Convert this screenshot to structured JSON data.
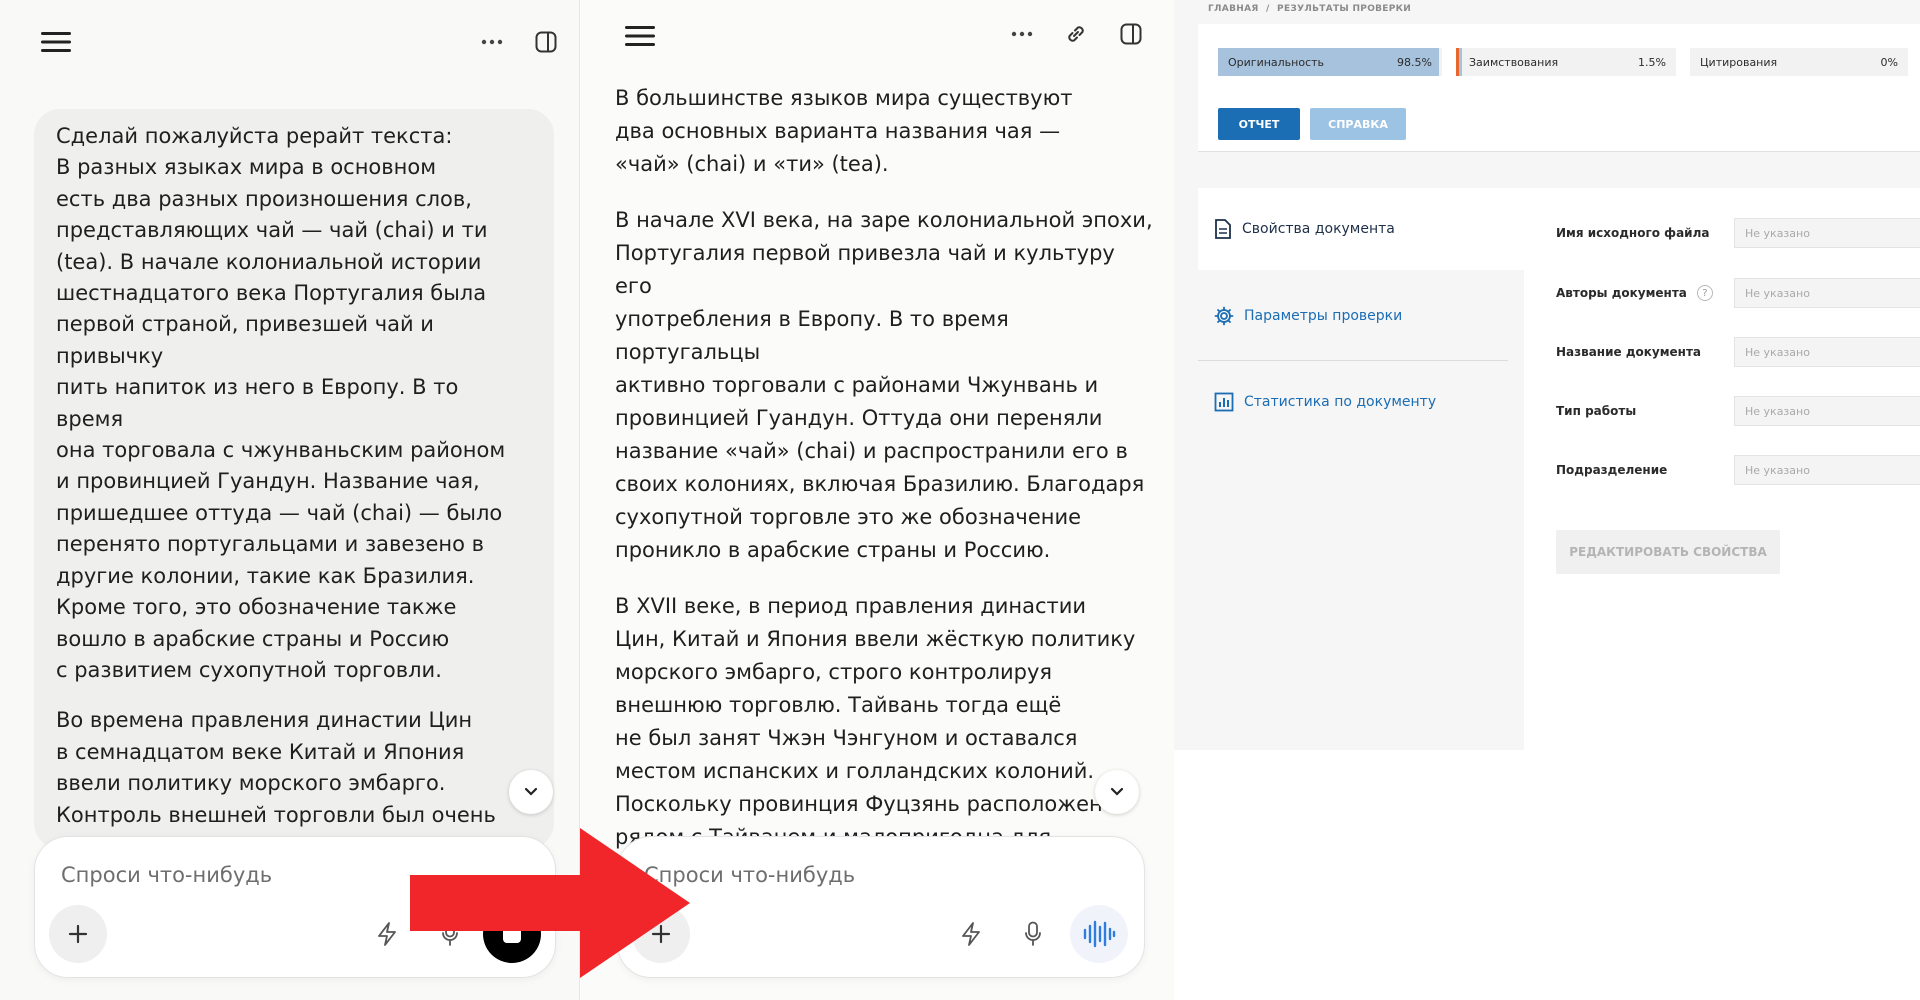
{
  "panel1": {
    "user_message": [
      "Сделай пожалуйста рерайт текста:\nВ разных языках мира в основном\nесть два разных произношения слов,\nпредставляющих чай — чай (chai) и ти\n(tea). В начале колониальной истории\nшестнадцатого века Португалия была\nпервой страной, привезшей чай и привычку\nпить напиток из него в Европу. В то время\nона торговала с чжунваньским районом\nи провинцией Гуандун. Название чая,\nпришедшее оттуда — чай (chai) — было\nперенято португальцами и завезено в\nдругие колонии, такие как Бразилия.\nКроме того, это обозначение также\nвошло в арабские страны и Россию\nс развитием сухопутной торговли.",
      "Во времена правления династии Цин\nв семнадцатом веке Китай и Япония\nввели политику морского эмбарго.\nКонтроль внешней торговли был очень\nстрогий. В то время Тайвань ещё не\nбыл оккупирован Чжэн Чэнгуном и"
    ],
    "composer_placeholder": "Спроси что-нибудь"
  },
  "panel2": {
    "answer": [
      "В большинстве языков мира существуют\nдва основных варианта названия чая —\n«чай» (chai) и «ти» (tea).",
      "В начале XVI века, на заре колониальной эпохи,\nПортугалия первой привезла чай и культуру его\nупотребления в Европу. В то время португальцы\nактивно торговали с районами Чжунвань и\nпровинцией Гуандун. Оттуда они переняли\nназвание «чай» (chai) и распространили его в\nсвоих колониях, включая Бразилию. Благодаря\nсухопутной торговле это же обозначение\nпроникло в арабские страны и Россию.",
      "В XVII веке, в период правления династии\nЦин, Китай и Япония ввели жёсткую политику\nморского эмбарго, строго контролируя\nвнешнюю торговлю. Тайвань тогда ещё\nне был занят Чжэн Чэнгуном и оставался\nместом испанских и голландских колоний.\nПоскольку провинция Фуцзянь расположена\nрядом с Тайванем и малопригодна для\nсельского хозяйства, местные жители\nк"
    ],
    "composer_placeholder": "Спроси что-нибудь"
  },
  "app": {
    "breadcrumb": [
      "ГЛАВНАЯ",
      "/",
      "РЕЗУЛЬТАТЫ ПРОВЕРКИ"
    ],
    "metrics": [
      {
        "label": "Оригинальность",
        "value": "98.5%",
        "fraction": 0.985
      },
      {
        "label": "Заимствования",
        "value": "1.5%",
        "fraction": 0.015
      },
      {
        "label": "Цитирования",
        "value": "0%",
        "fraction": 0
      }
    ],
    "buttons": {
      "report": "ОТЧЕТ",
      "help": "СПРАВКА",
      "edit": "РЕДАКТИРОВАТЬ СВОЙСТВА"
    },
    "sidebar": [
      {
        "label": "Свойства документа",
        "icon": "document-icon"
      },
      {
        "label": "Параметры проверки",
        "icon": "gear-icon"
      },
      {
        "label": "Статистика по документу",
        "icon": "chart-icon"
      }
    ],
    "fields": [
      {
        "label": "Имя исходного файла",
        "value": "Не указано"
      },
      {
        "label": "Авторы документа",
        "value": "Не указано",
        "help": "?"
      },
      {
        "label": "Название документа",
        "value": "Не указано"
      },
      {
        "label": "Тип работы",
        "value": "Не указано"
      },
      {
        "label": "Подразделение",
        "value": "Не указано"
      }
    ]
  },
  "colors": {
    "accent": "#1b6db4",
    "arrow": "#f0262a",
    "borrow_marker": "#e8672f",
    "voice_icon": "#2f7de0"
  }
}
